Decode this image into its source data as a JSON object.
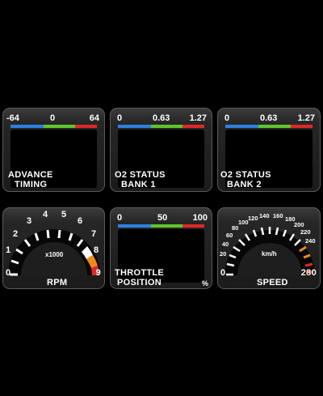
{
  "panels": {
    "advance_timing": {
      "min": "-64",
      "mid": "0",
      "max": "64",
      "label_line1": "ADVANCE",
      "label_line2": "TIMING"
    },
    "o2_bank1": {
      "min": "0",
      "mid": "0.63",
      "max": "1.27",
      "label_line1": "O2 STATUS",
      "label_line2": "BANK 1"
    },
    "o2_bank2": {
      "min": "0",
      "mid": "0.63",
      "max": "1.27",
      "label_line1": "O2 STATUS",
      "label_line2": "BANK 2"
    },
    "rpm": {
      "ticks": [
        "0",
        "1",
        "2",
        "3",
        "4",
        "5",
        "6",
        "7",
        "8",
        "9"
      ],
      "multiplier": "x1000",
      "min": "0",
      "max": "9",
      "label": "RPM"
    },
    "throttle": {
      "min": "0",
      "mid": "50",
      "max": "100",
      "label_line1": "THROTTLE",
      "label_line2": "POSITION",
      "unit": "%"
    },
    "speed": {
      "ticks": [
        "20",
        "40",
        "60",
        "80",
        "100",
        "120",
        "140",
        "160",
        "180",
        "200",
        "220",
        "240"
      ],
      "unit": "km/h",
      "min": "0",
      "max": "280",
      "label": "SPEED"
    }
  },
  "colors": {
    "blue": "#2e7fe0",
    "green": "#5ec62b",
    "red": "#e02828",
    "orange": "#f08a1c"
  }
}
